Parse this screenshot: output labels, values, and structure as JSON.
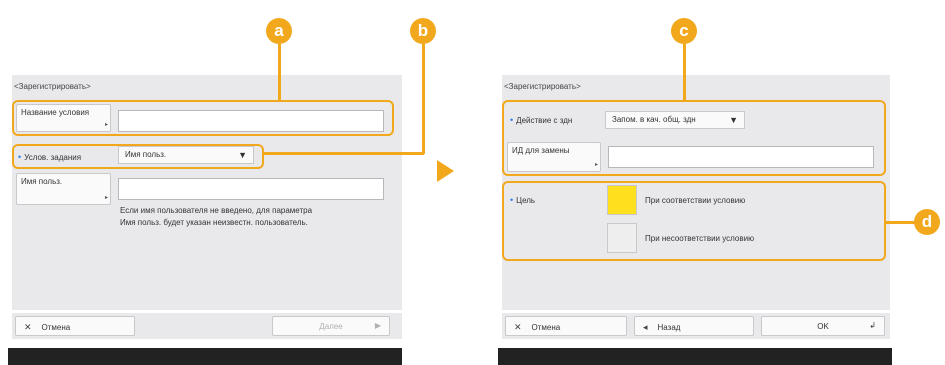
{
  "colors": {
    "accent": "#f2a81d",
    "panel_bg": "#e9e9ec",
    "target_match_swatch": "#ffe01f",
    "target_nomatch_swatch": "#eeeeee",
    "bullet": "#2a7de1"
  },
  "markers": {
    "a": "a",
    "b": "b",
    "c": "c",
    "d": "d"
  },
  "left": {
    "window_title": "<Зарегистрировать>",
    "condition_name_label": "Название условия",
    "condition_name_value": "",
    "condition_set_label": "Услов. задания",
    "condition_set_value": "Имя польз.",
    "username_label": "Имя польз.",
    "username_value": "",
    "note_line1": "Если имя пользователя не введено, для параметра",
    "note_line2": "Имя польз. будет указан неизвестн. пользователь.",
    "cancel_label": "Отмена",
    "next_label": "Далее"
  },
  "right": {
    "window_title": "<Зарегистрировать>",
    "action_label": "Действие с здн",
    "action_value": "Запом. в кач. общ. здн",
    "replace_id_label": "ИД для замены",
    "replace_id_value": "",
    "target_label": "Цель",
    "target_match_label": "При соответствии условию",
    "target_nomatch_label": "При несоответствии условию",
    "cancel_label": "Отмена",
    "back_label": "Назад",
    "ok_label": "OK"
  }
}
